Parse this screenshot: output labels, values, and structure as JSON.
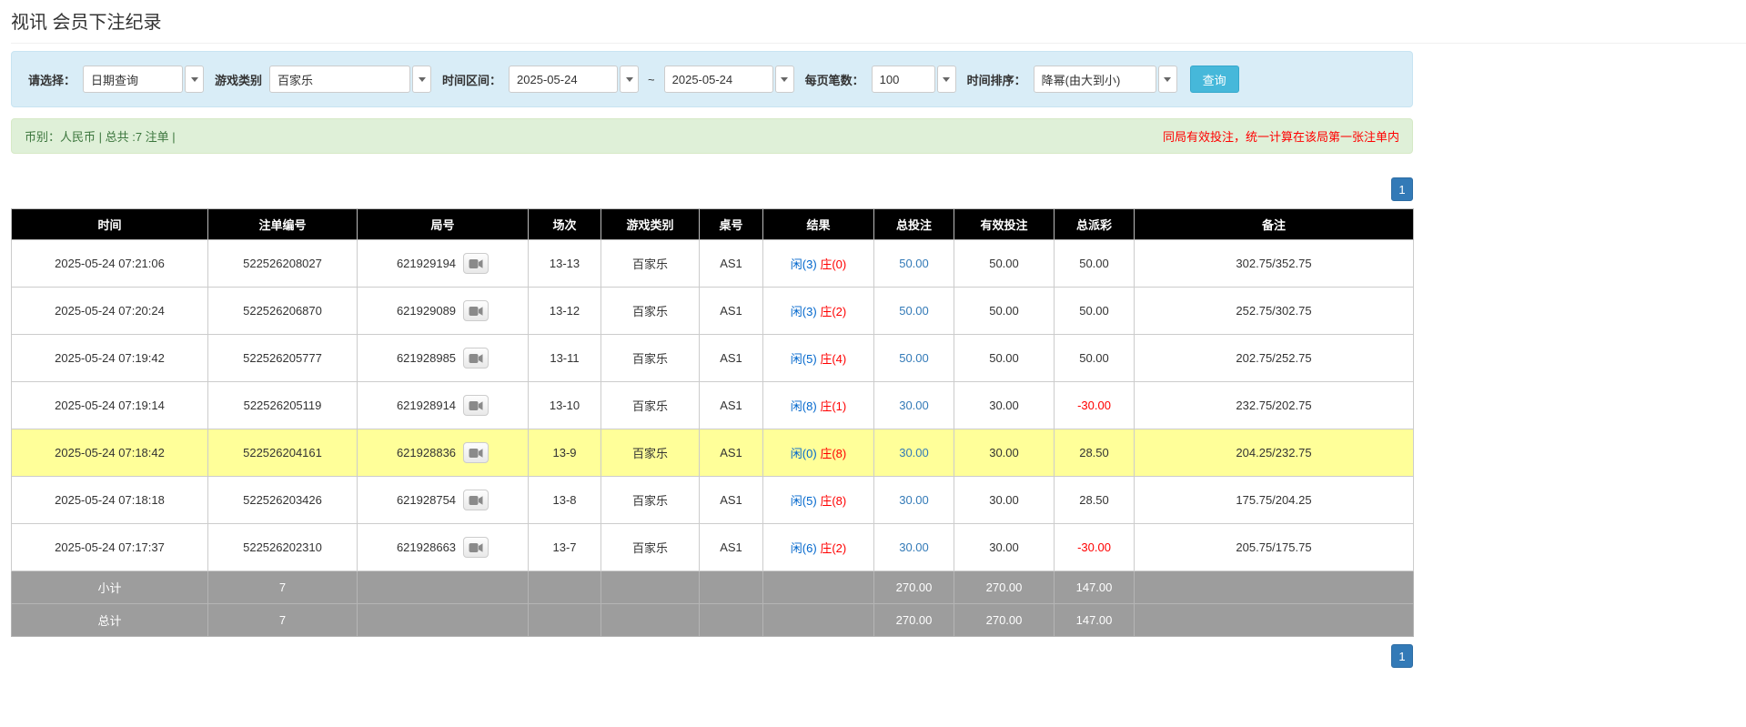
{
  "page": {
    "title": "视讯 会员下注纪录"
  },
  "filter": {
    "select_label": "请选择：",
    "select_value": "日期查询",
    "game_type_label": "游戏类别",
    "game_type_value": "百家乐",
    "time_range_label": "时间区间：",
    "date_from": "2025-05-24",
    "range_separator": "~",
    "date_to": "2025-05-24",
    "page_size_label": "每页笔数：",
    "page_size_value": "100",
    "sort_label": "时间排序：",
    "sort_value": "降幂(由大到小)",
    "search_button": "查询"
  },
  "summary": {
    "info": "币别：人民币 | 总共 :7 注单 |",
    "notice": "同局有效投注，统一计算在该局第一张注单内"
  },
  "pagination": {
    "page": "1"
  },
  "table": {
    "headers": [
      "时间",
      "注单编号",
      "局号",
      "场次",
      "游戏类别",
      "桌号",
      "结果",
      "总投注",
      "有效投注",
      "总派彩",
      "备注"
    ],
    "rows": [
      {
        "time": "2025-05-24 07:21:06",
        "bet_id": "522526208027",
        "round_id": "621929194",
        "session": "13-13",
        "game": "百家乐",
        "table_no": "AS1",
        "result_player": "闲(3)",
        "result_banker": "庄(0)",
        "total_bet": "50.00",
        "valid_bet": "50.00",
        "payout": "50.00",
        "remark": "302.75/352.75",
        "highlight": false
      },
      {
        "time": "2025-05-24 07:20:24",
        "bet_id": "522526206870",
        "round_id": "621929089",
        "session": "13-12",
        "game": "百家乐",
        "table_no": "AS1",
        "result_player": "闲(3)",
        "result_banker": "庄(2)",
        "total_bet": "50.00",
        "valid_bet": "50.00",
        "payout": "50.00",
        "remark": "252.75/302.75",
        "highlight": false
      },
      {
        "time": "2025-05-24 07:19:42",
        "bet_id": "522526205777",
        "round_id": "621928985",
        "session": "13-11",
        "game": "百家乐",
        "table_no": "AS1",
        "result_player": "闲(5)",
        "result_banker": "庄(4)",
        "total_bet": "50.00",
        "valid_bet": "50.00",
        "payout": "50.00",
        "remark": "202.75/252.75",
        "highlight": false
      },
      {
        "time": "2025-05-24 07:19:14",
        "bet_id": "522526205119",
        "round_id": "621928914",
        "session": "13-10",
        "game": "百家乐",
        "table_no": "AS1",
        "result_player": "闲(8)",
        "result_banker": "庄(1)",
        "total_bet": "30.00",
        "valid_bet": "30.00",
        "payout": "-30.00",
        "remark": "232.75/202.75",
        "highlight": false
      },
      {
        "time": "2025-05-24 07:18:42",
        "bet_id": "522526204161",
        "round_id": "621928836",
        "session": "13-9",
        "game": "百家乐",
        "table_no": "AS1",
        "result_player": "闲(0)",
        "result_banker": "庄(8)",
        "total_bet": "30.00",
        "valid_bet": "30.00",
        "payout": "28.50",
        "remark": "204.25/232.75",
        "highlight": true
      },
      {
        "time": "2025-05-24 07:18:18",
        "bet_id": "522526203426",
        "round_id": "621928754",
        "session": "13-8",
        "game": "百家乐",
        "table_no": "AS1",
        "result_player": "闲(5)",
        "result_banker": "庄(8)",
        "total_bet": "30.00",
        "valid_bet": "30.00",
        "payout": "28.50",
        "remark": "175.75/204.25",
        "highlight": false
      },
      {
        "time": "2025-05-24 07:17:37",
        "bet_id": "522526202310",
        "round_id": "621928663",
        "session": "13-7",
        "game": "百家乐",
        "table_no": "AS1",
        "result_player": "闲(6)",
        "result_banker": "庄(2)",
        "total_bet": "30.00",
        "valid_bet": "30.00",
        "payout": "-30.00",
        "remark": "205.75/175.75",
        "highlight": false
      }
    ],
    "subtotal": {
      "label": "小计",
      "count": "7",
      "total_bet": "270.00",
      "valid_bet": "270.00",
      "payout": "147.00"
    },
    "total": {
      "label": "总计",
      "count": "7",
      "total_bet": "270.00",
      "valid_bet": "270.00",
      "payout": "147.00"
    }
  },
  "colors": {
    "accent_blue": "#337ab7",
    "button_blue": "#46b8da",
    "player_blue": "#0066cc",
    "banker_red": "#ff0000",
    "negative_red": "#ff0000",
    "highlight_yellow": "#ffff99",
    "header_bg": "#000000",
    "footer_gray": "#9d9d9d",
    "filter_bg": "#d9edf7",
    "summary_bg": "#dff0d8",
    "summary_text": "#3c763d",
    "notice_red": "#ff0000"
  }
}
